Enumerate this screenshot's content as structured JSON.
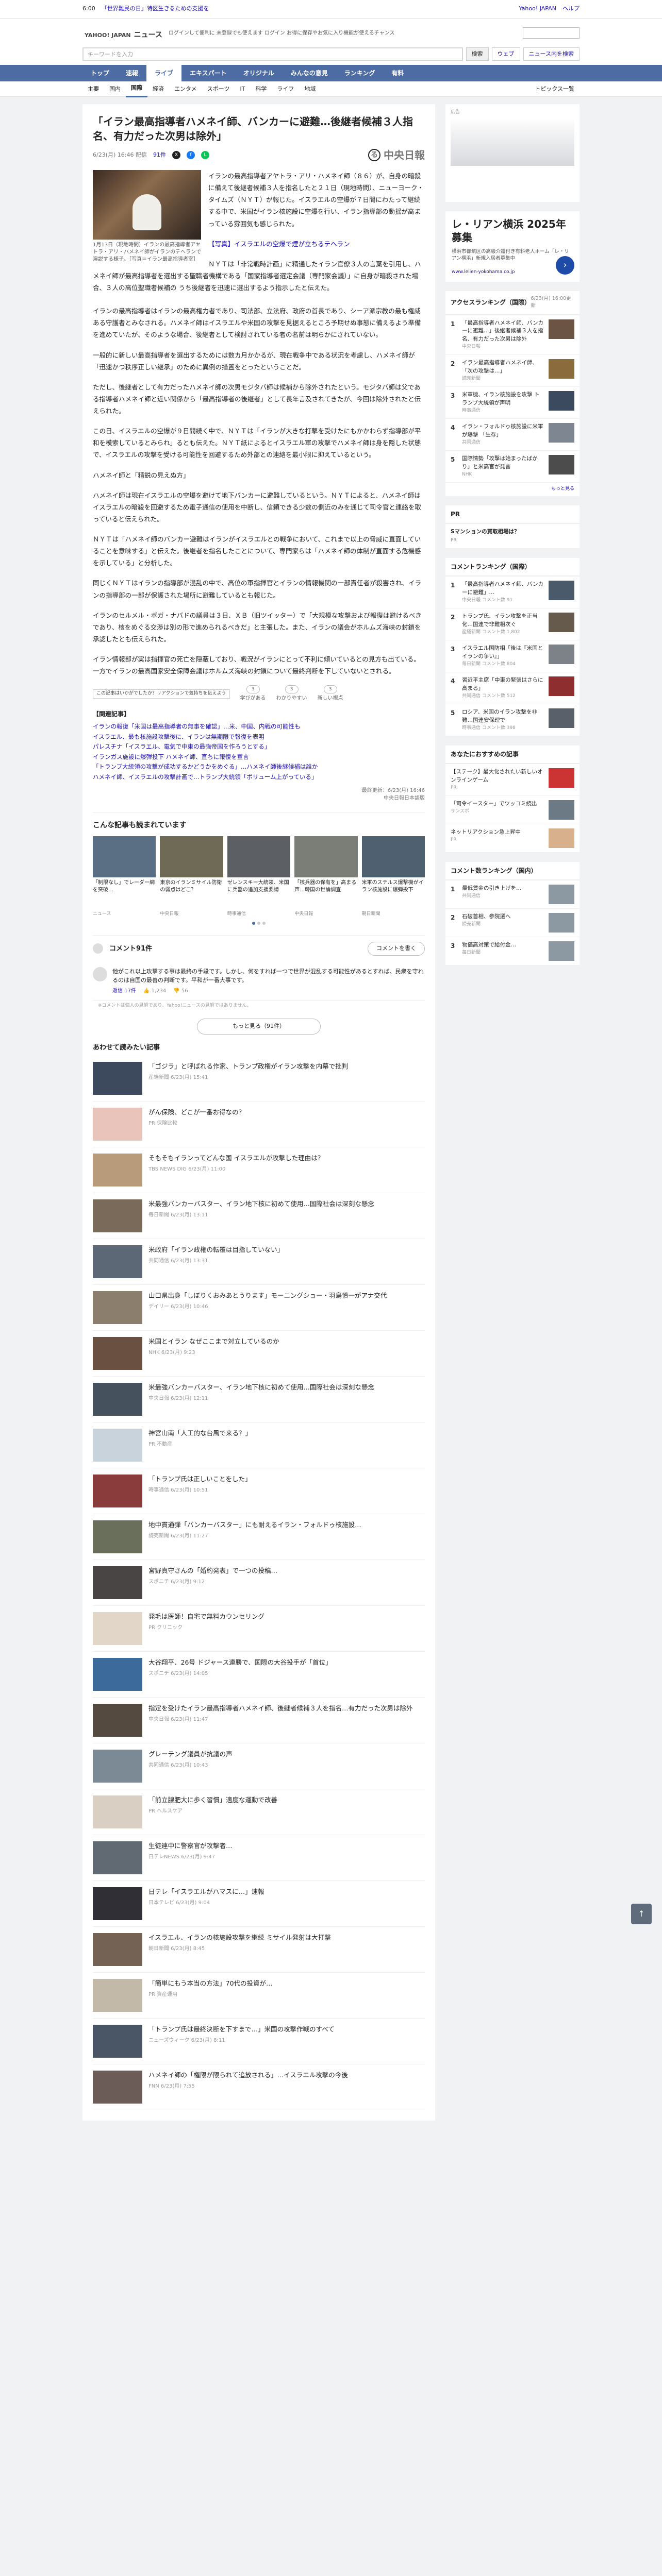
{
  "topbar": {
    "time": "6:00",
    "headline": "「世界難民の日」特区生きるための支援を",
    "links": [
      "Yahoo! JAPAN",
      "ヘルプ"
    ]
  },
  "header": {
    "logo": "YAHOO! JAPAN",
    "section": "ニュース",
    "promo": "ログインして便利に 未登録でも使えます\nログイン お得に保存やお気に入り機能が使えるチャンス",
    "search_placeholder": "キーワードを入力",
    "search_btn": "検索",
    "web_btn": "ウェブ",
    "news_btn": "ニュース内を検索"
  },
  "nav1": [
    "トップ",
    "速報",
    "ライブ",
    "エキスパート",
    "オリジナル",
    "みんなの意見",
    "ランキング",
    "有料"
  ],
  "nav1_active": 2,
  "nav2": [
    "主要",
    "国内",
    "国際",
    "経済",
    "エンタメ",
    "スポーツ",
    "IT",
    "科学",
    "ライフ",
    "地域"
  ],
  "nav2_active": 2,
  "nav2_right": "トピックス一覧",
  "article": {
    "title": "「イラン最高指導者ハメネイ師、バンカーに避難…後継者候補３人指名、有力だった次男は除外」",
    "date": "6/23(月) 16:46 配信",
    "comment_count": "91件",
    "publisher": "中央日報",
    "publisher_mark": "る",
    "caption": "1月13日（現地時間）イランの最高指導者アヤトラ・アリ・ハメネイ師がイランのテヘランで演説する様子。［写真＝イラン最高指導者室］",
    "photo_note": "【写真】イスラエルの空爆で煙が立ちるテヘラン",
    "paragraphs": [
      "イランの最高指導者アヤトラ・アリ・ハメネイ師（８６）が、自身の暗殺に備えて後継者候補３人を指名したと２１日（現地時間）、ニューヨーク・タイムズ（ＮＹＴ）が報じた。イスラエルの空爆が７日間にわたって継続する中で、米国がイラン核施設に空爆を行い、イラン指導部の動揺が高まっている雰囲気も感じられた。",
      "ＮＹＴは「非常戦時計画」に精通したイラン官僚３人の言葉を引用し、ハメネイ師が最高指導者を選出する聖職者機構である「国家指導者選定会議（専門家会議）」に自身が暗殺された場合、３人の高位聖職者候補の うち後継者を迅速に選出するよう指示したと伝えた。",
      "イランの最高指導者はイランの最高権力者であり、司法部、立法府、政府の首長であり、シーア派宗教の最も権威ある守護者とみなされる。ハメネイ師はイスラエルや米国の攻撃を見据えるところ予期せぬ事態に備えるよう準備を進めていたが、そのような場合、後継者として検討されている者の名前は明らかにされていない。",
      "一般的に新しい最高指導者を選出するためには数カ月かかるが、現在戦争中である状況を考慮し、ハメネイ師が「迅速かつ秩序正しい継承」のために異例の措置をとったということだ。",
      "ただし、後継者として有力だったハメネイ師の次男モジタバ師は候補から除外されたという。モジタバ師は父である指導者ハメネイ師と近い関係から「最高指導者の後継者」として長年言及されてきたが、今回は除外されたと伝えられた。",
      "この日、イスラエルの空爆が９日間続く中で、ＮＹＴは「イランが大きな打撃を受けたにもかかわらず指導部が平和を模索しているとみられ」るとも伝えた。ＮＹＴ紙によるとイスラエル軍の攻撃でハメネイ師は身を隠した状態で、イスラエルの攻撃を受ける可能性を回避するため外部との連絡を最小限に抑えているという。",
      "ハメネイ師と「精鋭の見えぬ方」",
      "ハメネイ師は現在イスラエルの空爆を避けて地下バンカーに避難しているという。ＮＹＴによると、ハメネイ師はイスラエルの暗殺を回避するため電子通信の使用を中断し、信頼できる少数の側近のみを通じて司令官と連絡を取っていると伝えられた。",
      "ＮＹＴは「ハメネイ師のバンカー避難はイランがイスラエルとの戦争において、これまで以上の脅威に直面していることを意味する」と伝えた。後継者を指名したことについて、専門家らは「ハメネイ師の体制が直面する危機感を示している」と分析した。",
      "同じくＮＹＴはイランの指導部が混乱の中で、高位の軍指揮官とイランの情報機関の一部責任者が殺害され、イランの指導部の一部が保護された場所に避難しているとも報じた。",
      "イランのセルメル・ボガ・ナバドの議員は３日、ＸＢ（旧ツイッター）で「大規模な攻撃および報復は避けるべきであり、核をめぐる交渉は別の形で進められるべきだ」と主張した。また、イランの議会がホルムズ海峡の封鎖を承認したとも伝えられた。",
      "イラン情報部が実は指揮官の死亡を隠蔽しており、戦況がイランにとって不利に傾いているとの見方も出ている。一方でイランの最高国家安全保障会議はホルムズ海峡の封鎖について最終判断を下していないとされる。"
    ],
    "reactions": [
      {
        "label": "学びがある",
        "count": "3"
      },
      {
        "label": "わかりやすい",
        "count": "3"
      },
      {
        "label": "新しい視点",
        "count": "3"
      }
    ],
    "reaction_tip": "この記事はいかがでしたか？リアクションで気持ちを伝えよう",
    "related_title": "【関連記事】",
    "related": [
      "イランの報復「米国は最高指導者の無事を確認」…米、中国、内戦の可能性も",
      "イスラエル、最も核施設攻撃後に、イランは無期限で報復を表明",
      "パレスチナ「イスラエル、電気で中東の最強帝国を作ろうとする」",
      "イランガス施設に爆弾投下 ハメネイ師、直ちに報復を宣言",
      "「トランプ大統領の攻撃が成功するかどうかをめぐる」…ハメネイ師後継候補は誰か",
      "ハメネイ師、イスラエルの攻撃計画で…トランプ大統領「ボリューム上がっている」"
    ],
    "copyright": "最終更新：6/23(月) 16:46",
    "copyright2": "中央日報日本語版"
  },
  "mini": {
    "title": "こんな記事も読まれています",
    "cards": [
      {
        "text": "「制限なし」でレーダー網を突破…",
        "source": "ニュース"
      },
      {
        "text": "東京のイランミサイル防衛の弱点はどこ？",
        "source": "中央日報"
      },
      {
        "text": "ゼレンスキー大統領、米国に兵器の追加支援要請",
        "source": "時事通信"
      },
      {
        "text": "「核兵器の保有を」高まる声…韓国の世論調査",
        "source": "中央日報"
      },
      {
        "text": "米軍のステルス爆撃機がイラン核施設に爆弾投下",
        "source": "朝日新聞"
      }
    ]
  },
  "comments": {
    "title": "コメント91件",
    "write_btn": "コメントを書く",
    "items": [
      {
        "text": "他がこれ以上攻撃する事は最終の手段です。しかし、何をすれば一つで世界が混乱する可能性があるとすれば、民衆を守れるのは自国の最善の判断です。平和が一番大事です。",
        "meta": "返信 17件",
        "likes": "1,234",
        "dislikes": "56"
      }
    ],
    "notice": "※コメントは個人の見解であり、Yahoo!ニュースの見解ではありません。",
    "more_btn": "もっと見る（91件）"
  },
  "recommend": {
    "title": "あわせて読みたい記事",
    "items": [
      {
        "text": "「ゴジラ」と呼ばれる作家、トランプ政権がイラン攻撃を内幕で批判",
        "source": "産経新聞 6/23(月) 15:41"
      },
      {
        "text": "がん保険、どこが一番お得なの？",
        "source": "PR 保険比較"
      },
      {
        "text": "そもそもイランってどんな国 イスラエルが攻撃した理由は？",
        "source": "TBS NEWS DIG 6/23(月) 11:00"
      },
      {
        "text": "米最強バンカーバスター、イラン地下核に初めて使用…国際社会は深刻な懸念",
        "source": "毎日新聞 6/23(月) 13:11"
      },
      {
        "text": "米政府「イラン政権の転覆は目指していない」",
        "source": "共同通信 6/23(月) 13:31"
      },
      {
        "text": "山口県出身「しぼりくおみあとうります」モーニングショー・羽鳥慎一がアナ交代",
        "source": "デイリー 6/23(月) 10:46"
      },
      {
        "text": "米国とイラン なぜここまで対立しているのか",
        "source": "NHK 6/23(月) 9:23"
      },
      {
        "text": "米最強バンカーバスター、イラン地下核に初めて使用…国際社会は深刻な懸念",
        "source": "中央日報 6/23(月) 12:11"
      },
      {
        "text": "神宮山南「人工的な台風で来る？」",
        "source": "PR 不動産"
      },
      {
        "text": "「トランプ氏は正しいことをした」",
        "source": "時事通信 6/23(月) 10:51"
      },
      {
        "text": "地中貫通弾「バンカーバスター」にも耐えるイラン・フォルドゥ核施設…",
        "source": "読売新聞 6/23(月) 11:27"
      },
      {
        "text": "宮野真守さんの「婚約発表」で一つの投稿…",
        "source": "スポニチ 6/23(月) 9:12"
      },
      {
        "text": "発毛は医師！自宅で無料カウンセリング",
        "source": "PR クリニック"
      },
      {
        "text": "大谷翔平、26号 ドジャース連勝で、国際の大谷投手が「首位」",
        "source": "スポニチ 6/23(月) 14:05"
      },
      {
        "text": "指定を受けたイラン最高指導者ハメネイ師、後継者候補３人を指名…有力だった次男は除外",
        "source": "中央日報 6/23(月) 11:47"
      },
      {
        "text": "グレーテング議員が抗議の声",
        "source": "共同通信 6/23(月) 10:43"
      },
      {
        "text": "「前立腺肥大に歩く習慣」適度な運動で改善",
        "source": "PR ヘルスケア"
      },
      {
        "text": "生徒連中に警察官が攻撃者…",
        "source": "日テレNEWS 6/23(月) 9:47"
      },
      {
        "text": "日テレ「イスラエルがハマスに…」速報",
        "source": "日本テレビ 6/23(月) 9:04"
      },
      {
        "text": "イスラエル、イランの核施設攻撃を継続 ミサイル発射は大打撃",
        "source": "朝日新聞 6/23(月) 8:45"
      },
      {
        "text": "「簡単にもう本当の方法」70代の投資が…",
        "source": "PR 資産運用"
      },
      {
        "text": "「トランプ氏は最終決断を下すまで…」米国の攻撃作戦のすべて",
        "source": "ニューズウィーク 6/23(月) 8:11"
      },
      {
        "text": "ハメネイ師の「権限が限られて追放される」…イスラエル攻撃の今後",
        "source": "FNN 6/23(月) 7:55"
      }
    ]
  },
  "ads": {
    "top_label": "広告",
    "ad2_title": "レ・リアン横浜 2025年募集",
    "ad2_text": "横浜市都筑区の高級介護付き有料老人ホーム「レ・リアン横浜」新規入居者募集中",
    "ad2_url": "www.lelien-yokohama.co.jp",
    "arrow": "›"
  },
  "ranking": {
    "title": "アクセスランキング（国際）",
    "sub": "6/23(月) 16:00更新",
    "items": [
      {
        "n": "1",
        "t": "「最高指導者ハメネイ師、バンカーに避難…」後継者候補３人を指名、有力だった次男は除外",
        "s": "中央日報"
      },
      {
        "n": "2",
        "t": "イラン最高指導者ハメネイ師、「次の攻撃は…」",
        "s": "読売新聞"
      },
      {
        "n": "3",
        "t": "米軍機、イラン核施設を攻撃 トランプ大統領が声明",
        "s": "時事通信"
      },
      {
        "n": "4",
        "t": "イラン・フォルドゥ核施設に米軍が爆撃 「生存」",
        "s": "共同通信"
      },
      {
        "n": "5",
        "t": "国際情勢「攻撃は始まったばかり」と米高官が発言",
        "s": "NHK"
      }
    ],
    "more": "もっと見る"
  },
  "pr": {
    "title": "PR",
    "items": [
      {
        "b": "Sマンションの買取相場は？",
        "s": "PR"
      }
    ]
  },
  "comment_rank": {
    "title": "コメントランキング（国際）",
    "items": [
      {
        "n": "1",
        "t": "「最高指導者ハメネイ師、バンカーに避難」…",
        "s": "中央日報 コメント数 91"
      },
      {
        "n": "2",
        "t": "トランプ氏、イラン攻撃を正当化…国連で非難相次ぐ",
        "s": "産経新聞 コメント数 1,802"
      },
      {
        "n": "3",
        "t": "イスラエル国防相「後は『米国とイランの争い』」",
        "s": "毎日新聞 コメント数 804"
      },
      {
        "n": "4",
        "t": "習近平主席「中東の緊張はさらに高まる」",
        "s": "共同通信 コメント数 512"
      },
      {
        "n": "5",
        "t": "ロシア、米国のイラン攻撃を非難…国連安保理で",
        "s": "時事通信 コメント数 398"
      }
    ]
  },
  "recommend_side": {
    "title": "あなたにおすすめの記事",
    "items": [
      {
        "t": "【ステーク】最大化されたい新しいオンラインゲーム",
        "s": "PR"
      },
      {
        "t": "「司令イースター」でツッコミ続出",
        "s": "サンスポ"
      },
      {
        "t": "ネットリアクション急上昇中",
        "s": "PR"
      }
    ]
  },
  "bottom_rank": {
    "title": "コメント数ランキング（国内）",
    "items": [
      {
        "n": "1",
        "t": "最低賃金の引き上げを…",
        "s": "共同通信"
      },
      {
        "n": "2",
        "t": "石破首相、参院選へ",
        "s": "読売新聞"
      },
      {
        "n": "3",
        "t": "物価高対策で給付金…",
        "s": "毎日新聞"
      }
    ]
  },
  "page_top": "↑"
}
